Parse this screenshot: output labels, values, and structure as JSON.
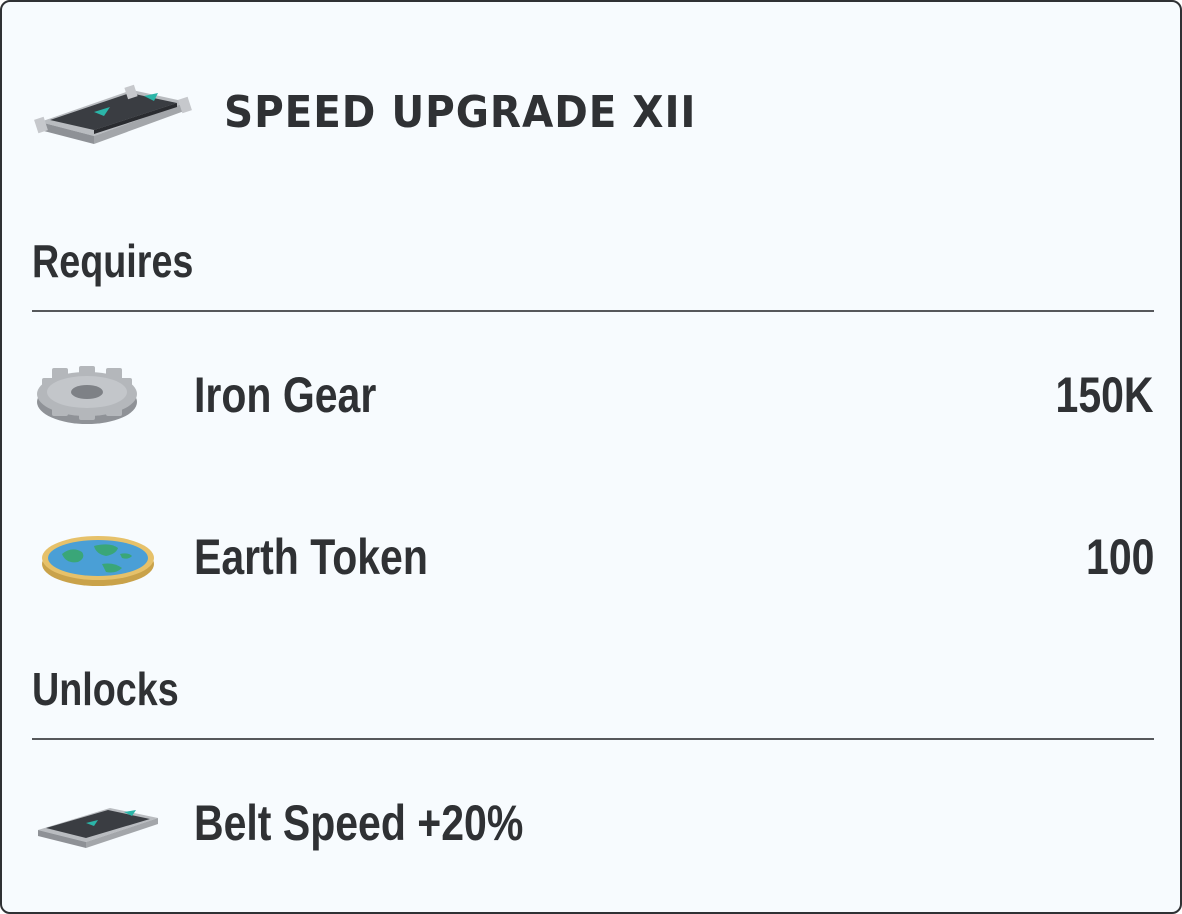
{
  "title": "SPEED UPGRADE XII",
  "header_icon": "conveyor-belt-icon",
  "requires": {
    "heading": "Requires",
    "items": [
      {
        "icon": "iron-gear-icon",
        "label": "Iron Gear",
        "amount": "150K"
      },
      {
        "icon": "earth-token-icon",
        "label": "Earth Token",
        "amount": "100"
      }
    ]
  },
  "unlocks": {
    "heading": "Unlocks",
    "items": [
      {
        "icon": "conveyor-belt-icon",
        "label": "Belt Speed +20%"
      }
    ]
  },
  "colors": {
    "background": "#f7fbfe",
    "border": "#2f3134",
    "text": "#2f3134",
    "divider": "#56585b",
    "belt_accent": "#2bb5a8",
    "token_blue": "#4a9fd6",
    "token_gold": "#e0b860",
    "gear_gray": "#a8abb0"
  }
}
